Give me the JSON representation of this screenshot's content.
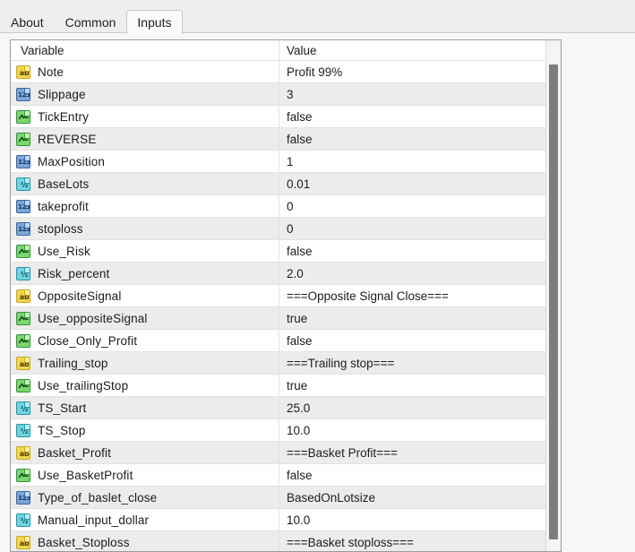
{
  "window": {
    "tabs": [
      {
        "label": "About",
        "active": false
      },
      {
        "label": "Common",
        "active": false
      },
      {
        "label": "Inputs",
        "active": true
      }
    ]
  },
  "grid": {
    "columns": {
      "variable": "Variable",
      "value": "Value"
    },
    "rows": [
      {
        "icon": "string-type-icon",
        "type": "string",
        "glyph": "ab",
        "name": "Note",
        "value": "Profit 99%"
      },
      {
        "icon": "int-type-icon",
        "type": "int",
        "glyph": "123",
        "name": "Slippage",
        "value": "3"
      },
      {
        "icon": "bool-type-icon",
        "type": "bool",
        "glyph": "",
        "name": "TickEntry",
        "value": "false"
      },
      {
        "icon": "bool-type-icon",
        "type": "bool",
        "glyph": "",
        "name": "REVERSE",
        "value": "false"
      },
      {
        "icon": "int-type-icon",
        "type": "int",
        "glyph": "123",
        "name": "MaxPosition",
        "value": "1"
      },
      {
        "icon": "double-type-icon",
        "type": "double",
        "glyph": "½",
        "name": "BaseLots",
        "value": "0.01"
      },
      {
        "icon": "int-type-icon",
        "type": "int",
        "glyph": "123",
        "name": "takeprofit",
        "value": "0"
      },
      {
        "icon": "int-type-icon",
        "type": "int",
        "glyph": "123",
        "name": "stoploss",
        "value": "0"
      },
      {
        "icon": "bool-type-icon",
        "type": "bool",
        "glyph": "",
        "name": "Use_Risk",
        "value": "false"
      },
      {
        "icon": "double-type-icon",
        "type": "double",
        "glyph": "½",
        "name": "Risk_percent",
        "value": "2.0"
      },
      {
        "icon": "string-type-icon",
        "type": "string",
        "glyph": "ab",
        "name": "OppositeSignal",
        "value": "===Opposite Signal Close==="
      },
      {
        "icon": "bool-type-icon",
        "type": "bool",
        "glyph": "",
        "name": "Use_oppositeSignal",
        "value": "true"
      },
      {
        "icon": "bool-type-icon",
        "type": "bool",
        "glyph": "",
        "name": "Close_Only_Profit",
        "value": "false"
      },
      {
        "icon": "string-type-icon",
        "type": "string",
        "glyph": "ab",
        "name": "Trailing_stop",
        "value": "===Trailing stop==="
      },
      {
        "icon": "bool-type-icon",
        "type": "bool",
        "glyph": "",
        "name": "Use_trailingStop",
        "value": "true"
      },
      {
        "icon": "double-type-icon",
        "type": "double",
        "glyph": "½",
        "name": "TS_Start",
        "value": "25.0"
      },
      {
        "icon": "double-type-icon",
        "type": "double",
        "glyph": "½",
        "name": "TS_Stop",
        "value": "10.0"
      },
      {
        "icon": "string-type-icon",
        "type": "string",
        "glyph": "ab",
        "name": "Basket_Profit",
        "value": "===Basket Profit==="
      },
      {
        "icon": "bool-type-icon",
        "type": "bool",
        "glyph": "",
        "name": "Use_BasketProfit",
        "value": "false"
      },
      {
        "icon": "int-type-icon",
        "type": "int",
        "glyph": "123",
        "name": "Type_of_baslet_close",
        "value": "BasedOnLotsize"
      },
      {
        "icon": "double-type-icon",
        "type": "double",
        "glyph": "½",
        "name": "Manual_input_dollar",
        "value": "10.0"
      },
      {
        "icon": "string-type-icon",
        "type": "string",
        "glyph": "ab",
        "name": "Basket_Stoploss",
        "value": "===Basket stoploss==="
      }
    ]
  },
  "scrollbar": {
    "orientation": "vertical",
    "thumb_name": "vertical-scrollbar-thumb"
  },
  "colors": {
    "string_icon": "#f2d64b",
    "int_icon": "#7ba7d7",
    "double_icon": "#6fd4e0",
    "bool_icon": "#7bd66f",
    "row_alt": "#ececec",
    "grid_border": "#9c9c9c",
    "tab_bar": "#eeeeee"
  }
}
